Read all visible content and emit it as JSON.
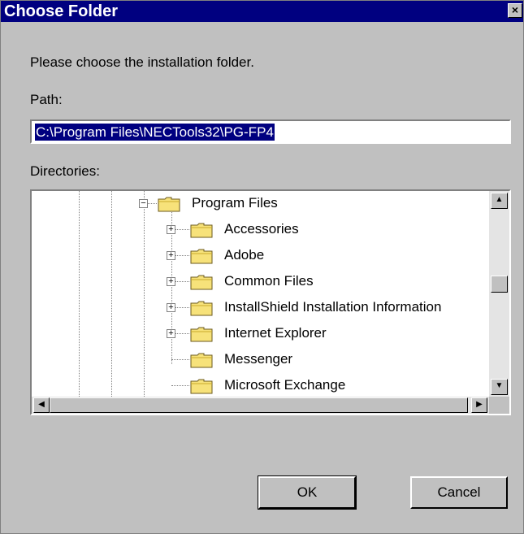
{
  "dialog": {
    "title": "Choose Folder",
    "close_glyph": "×"
  },
  "prompt": "Please choose the installation folder.",
  "path": {
    "label": "Path:",
    "value": "C:\\Program Files\\NECTools32\\PG-FP4"
  },
  "directories": {
    "label": "Directories:",
    "items": [
      {
        "label": "Program Files",
        "expander": "−"
      },
      {
        "label": "Accessories",
        "expander": "+"
      },
      {
        "label": "Adobe",
        "expander": "+"
      },
      {
        "label": "Common Files",
        "expander": "+"
      },
      {
        "label": "InstallShield Installation Information",
        "expander": "+"
      },
      {
        "label": "Internet Explorer",
        "expander": "+"
      },
      {
        "label": "Messenger",
        "expander": ""
      },
      {
        "label": "Microsoft Exchange",
        "expander": ""
      }
    ]
  },
  "scrollbar": {
    "up": "▲",
    "down": "▼",
    "left": "◀",
    "right": "▶"
  },
  "buttons": {
    "ok": "OK",
    "cancel": "Cancel"
  }
}
